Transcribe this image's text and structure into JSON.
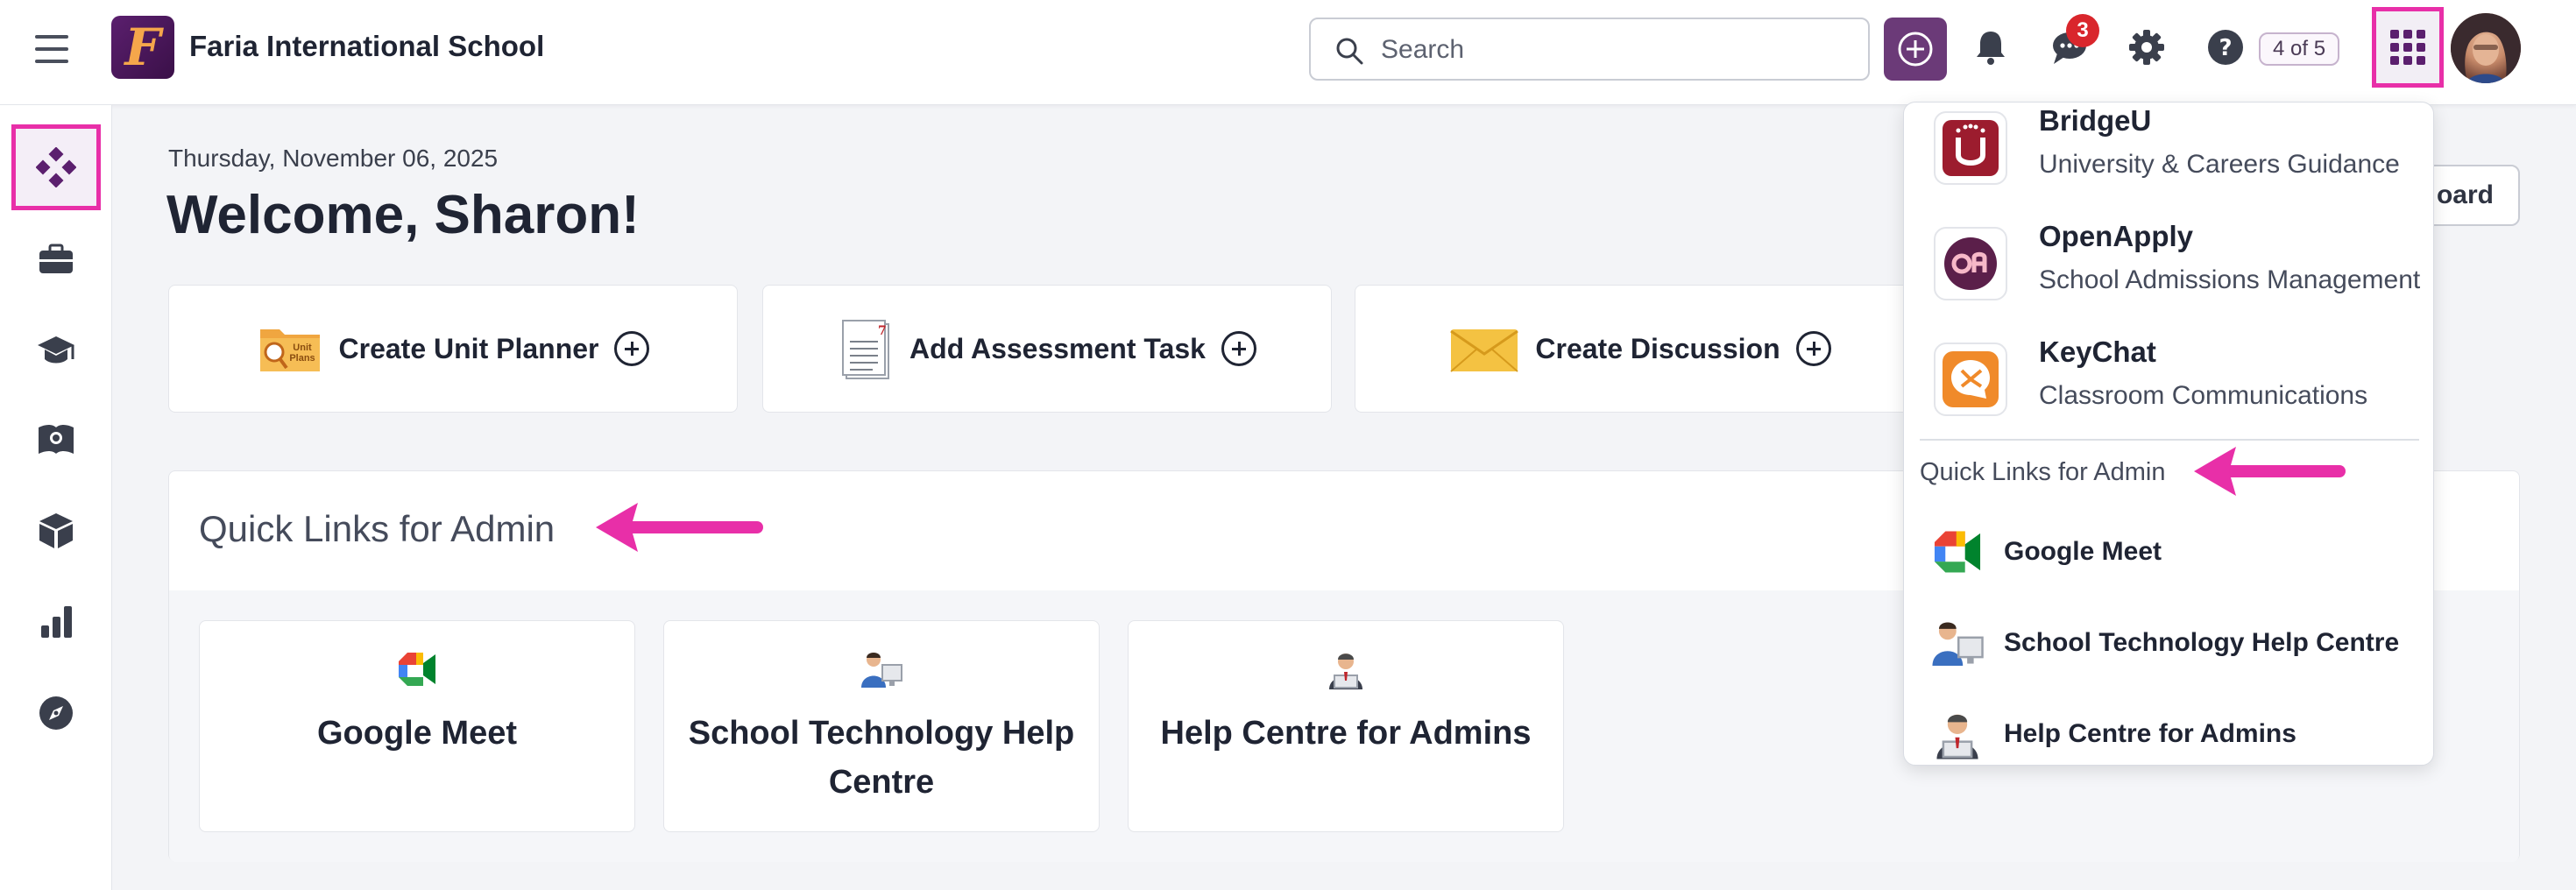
{
  "header": {
    "school_name": "Faria International School",
    "logo_letter": "F",
    "search_placeholder": "Search",
    "messages_badge": "3",
    "account_count": "4 of 5"
  },
  "sidebar": {
    "items": [
      "home-icon",
      "briefcase-icon",
      "graduation-cap-icon",
      "atlas-book-icon",
      "cube-icon",
      "bar-chart-icon",
      "compass-icon"
    ]
  },
  "main": {
    "date": "Thursday, November 06, 2025",
    "welcome": "Welcome, Sharon!",
    "dashboard_button": "oard",
    "actions": [
      {
        "label": "Create Unit Planner",
        "icon": "unit-plans-folder-icon"
      },
      {
        "label": "Add Assessment Task",
        "icon": "assessment-clipboard-icon"
      },
      {
        "label": "Create Discussion",
        "icon": "envelope-icon"
      }
    ],
    "quick_links_title": "Quick Links for Admin",
    "quick_links": [
      {
        "label": "Google Meet",
        "icon": "google-meet-icon"
      },
      {
        "label": "School Technology Help Centre",
        "icon": "tech-support-person-icon"
      },
      {
        "label": "Help Centre for Admins",
        "icon": "admin-person-icon"
      }
    ]
  },
  "apps_dropdown": {
    "apps": [
      {
        "name": "BridgeU",
        "desc": "University & Careers Guidance",
        "icon": "bridgeu-logo"
      },
      {
        "name": "OpenApply",
        "desc": "School Admissions Management",
        "icon": "openapply-logo"
      },
      {
        "name": "KeyChat",
        "desc": "Classroom Communications",
        "icon": "keychat-logo"
      }
    ],
    "section_title": "Quick Links for Admin",
    "links": [
      {
        "label": "Google Meet",
        "icon": "google-meet-icon"
      },
      {
        "label": "School Technology Help Centre",
        "icon": "tech-support-person-icon"
      },
      {
        "label": "Help Centre for Admins",
        "icon": "admin-person-icon"
      }
    ]
  },
  "colors": {
    "brand_purple": "#5b1f6e",
    "highlight_pink": "#e82fa8",
    "badge_red": "#d9262c"
  }
}
